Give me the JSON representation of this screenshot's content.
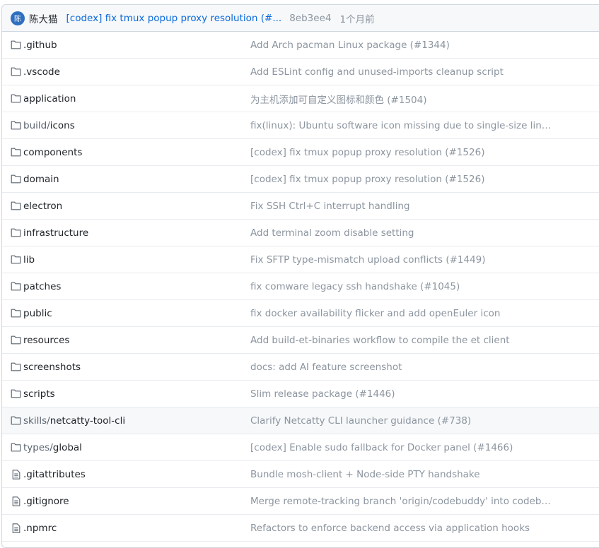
{
  "latest_commit": {
    "avatar_text": "陈",
    "author": "陈大猫",
    "message": "[codex] fix tmux popup proxy resolution (#...",
    "sha": "8eb3ee4",
    "time": "1个月前"
  },
  "files": [
    {
      "type": "folder",
      "name": ".github",
      "message": "Add Arch pacman Linux package (#1344)"
    },
    {
      "type": "folder",
      "name": ".vscode",
      "message": "Add ESLint config and unused-imports cleanup script"
    },
    {
      "type": "folder",
      "name": "application",
      "message": "为主机添加可自定义图标和颜色 (#1504)"
    },
    {
      "type": "folder",
      "name": "build/icons",
      "message": "fix(linux): Ubuntu software icon missing due to single-size linux.icon..."
    },
    {
      "type": "folder",
      "name": "components",
      "message": "[codex] fix tmux popup proxy resolution (#1526)"
    },
    {
      "type": "folder",
      "name": "domain",
      "message": "[codex] fix tmux popup proxy resolution (#1526)"
    },
    {
      "type": "folder",
      "name": "electron",
      "message": "Fix SSH Ctrl+C interrupt handling"
    },
    {
      "type": "folder",
      "name": "infrastructure",
      "message": "Add terminal zoom disable setting"
    },
    {
      "type": "folder",
      "name": "lib",
      "message": "Fix SFTP type-mismatch upload conflicts (#1449)"
    },
    {
      "type": "folder",
      "name": "patches",
      "message": "fix comware legacy ssh handshake (#1045)"
    },
    {
      "type": "folder",
      "name": "public",
      "message": "fix docker availability flicker and add openEuler icon"
    },
    {
      "type": "folder",
      "name": "resources",
      "message": "Add build-et-binaries workflow to compile the et client"
    },
    {
      "type": "folder",
      "name": "screenshots",
      "message": "docs: add AI feature screenshot"
    },
    {
      "type": "folder",
      "name": "scripts",
      "message": "Slim release package (#1446)"
    },
    {
      "type": "folder",
      "name": "skills/netcatty-tool-cli",
      "message": "Clarify Netcatty CLI launcher guidance (#738)"
    },
    {
      "type": "folder",
      "name": "types/global",
      "message": "[codex] Enable sudo fallback for Docker panel (#1466)"
    },
    {
      "type": "file",
      "name": ".gitattributes",
      "message": "Bundle mosh-client + Node-side PTY handshake"
    },
    {
      "type": "file",
      "name": ".gitignore",
      "message": "Merge remote-tracking branch 'origin/codebuddy' into codebuddy"
    },
    {
      "type": "file",
      "name": ".npmrc",
      "message": "Refactors to enforce backend access via application hooks"
    }
  ],
  "hovered_row": 14
}
